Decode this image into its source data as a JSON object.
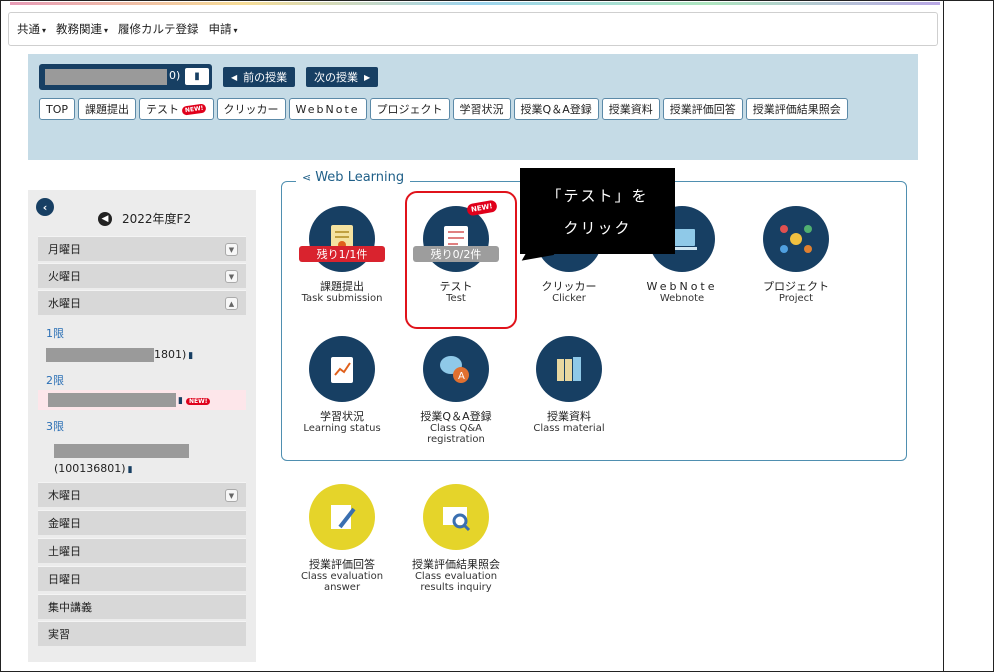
{
  "nav": {
    "items": [
      {
        "label": "共通"
      },
      {
        "label": "教務関連"
      },
      {
        "label": "履修カルテ登録"
      },
      {
        "label": "申請"
      }
    ]
  },
  "course": {
    "name_suffix": "0)",
    "prev_label": "前の授業",
    "next_label": "次の授業",
    "tabs": [
      "TOP",
      "課題提出",
      "テスト",
      "クリッカー",
      "WebNote",
      "プロジェクト",
      "学習状況",
      "授業Q＆A登録",
      "授業資料",
      "授業評価回答",
      "授業評価結果照会"
    ],
    "new_label": "NEW!"
  },
  "sidebar": {
    "year": "2022年度F2",
    "days": [
      "月曜日",
      "火曜日",
      "水曜日",
      "木曜日",
      "金曜日",
      "土曜日",
      "日曜日",
      "集中講義",
      "実習"
    ],
    "periods": [
      "1限",
      "2限",
      "3限"
    ],
    "lecture1_fragment": "1801)",
    "lecture3_code": "(100136801)"
  },
  "web_learning": {
    "title": "Web Learning",
    "tiles": [
      {
        "jp": "課題提出",
        "en": "Task submission",
        "badge": "残り1/1件"
      },
      {
        "jp": "テスト",
        "en": "Test",
        "badge": "残り0/2件"
      },
      {
        "jp": "クリッカー",
        "en": "Clicker"
      },
      {
        "jp": "WebNote",
        "en": "Webnote"
      },
      {
        "jp": "プロジェクト",
        "en": "Project"
      },
      {
        "jp": "学習状況",
        "en": "Learning status"
      },
      {
        "jp": "授業Q＆A登録",
        "en": "Class Q&A registration"
      },
      {
        "jp": "授業資料",
        "en": "Class material"
      }
    ]
  },
  "evaluation": {
    "tiles": [
      {
        "jp": "授業評価回答",
        "en1": "Class evaluation",
        "en2": "answer"
      },
      {
        "jp": "授業評価結果照会",
        "en1": "Class evaluation",
        "en2": "results inquiry"
      }
    ]
  },
  "callout": {
    "line1": "「テスト」を",
    "line2": "クリック"
  },
  "colors": {
    "navy": "#173f63",
    "panel": "#c5dbe6",
    "red": "#e0131b",
    "yellow": "#e5d42a"
  }
}
